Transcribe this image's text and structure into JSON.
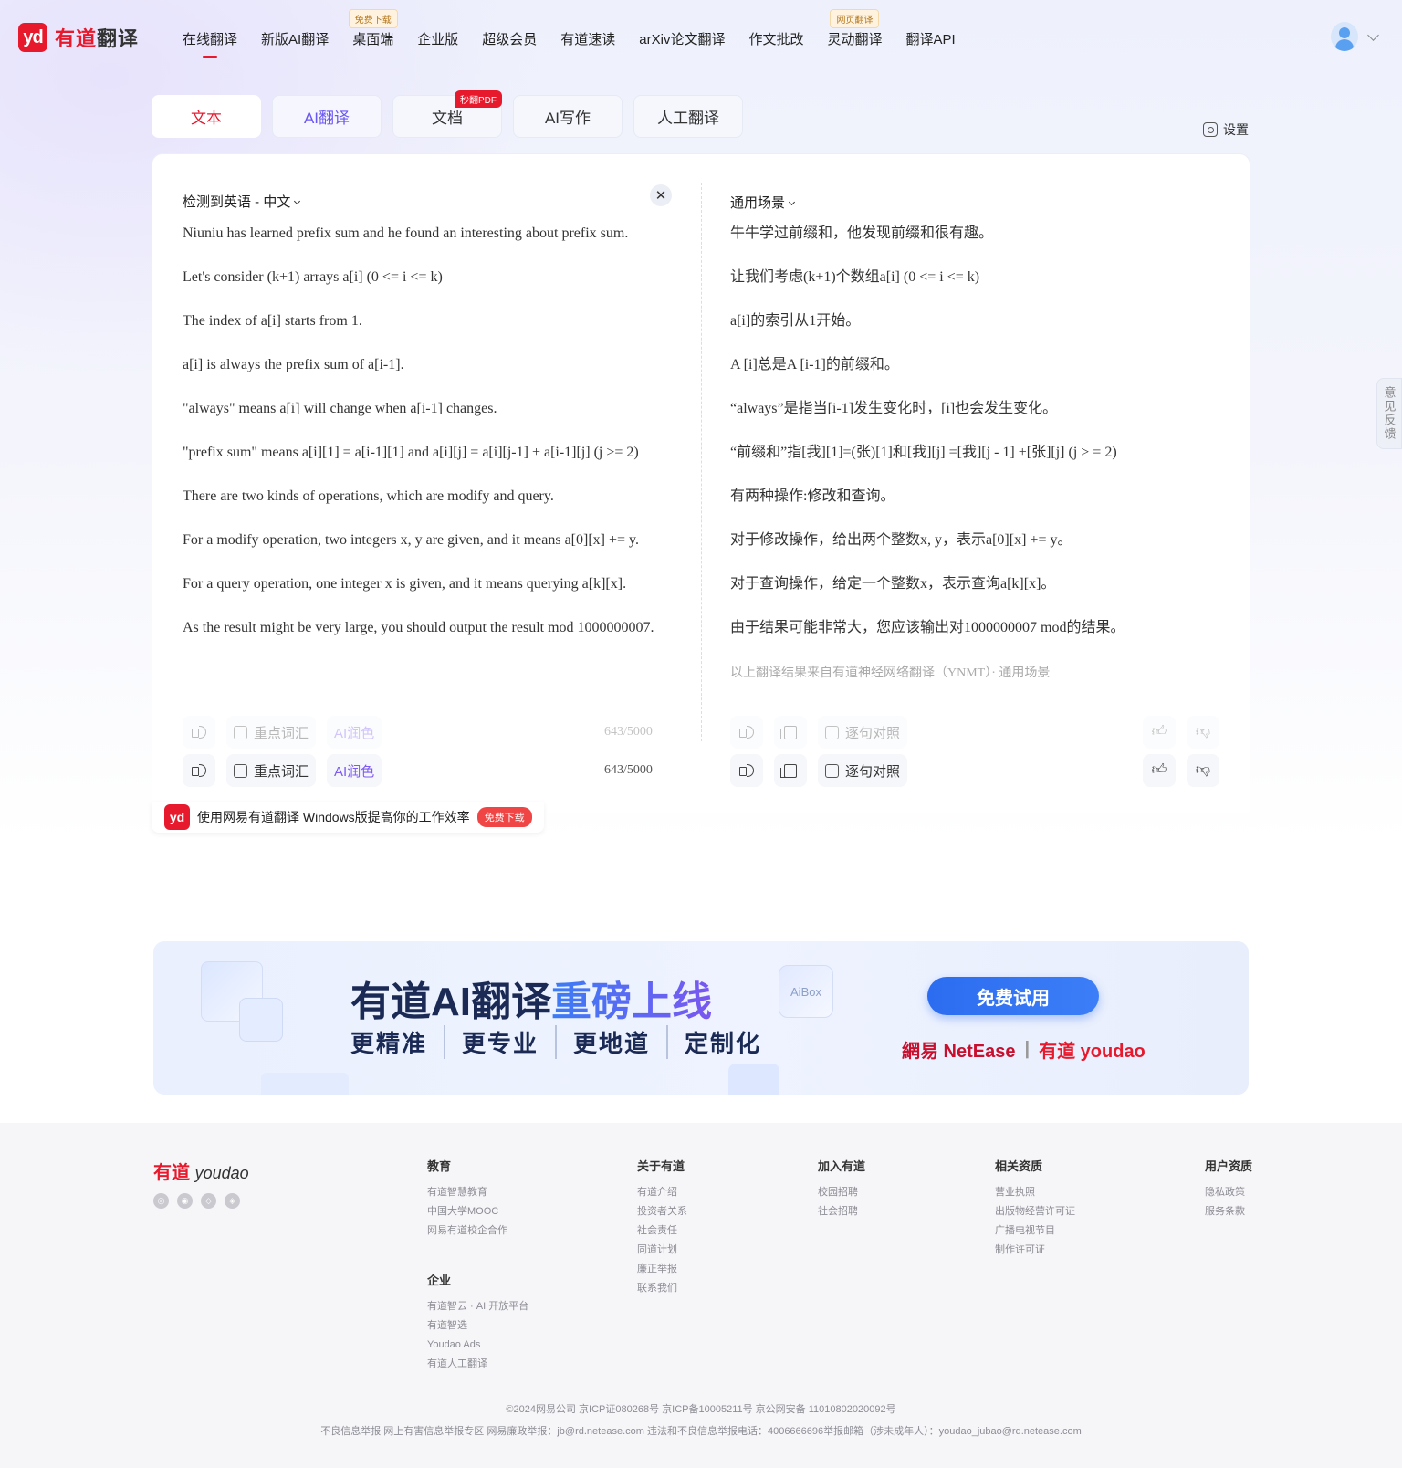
{
  "header": {
    "logo_badge": "yd",
    "logo_brand": "有道",
    "logo_product": "翻译",
    "nav": [
      {
        "label": "在线翻译",
        "tag": ""
      },
      {
        "label": "新版AI翻译",
        "tag": ""
      },
      {
        "label": "桌面端",
        "tag": "免费下载"
      },
      {
        "label": "企业版",
        "tag": ""
      },
      {
        "label": "超级会员",
        "tag": ""
      },
      {
        "label": "有道速读",
        "tag": ""
      },
      {
        "label": "arXiv论文翻译",
        "tag": ""
      },
      {
        "label": "作文批改",
        "tag": ""
      },
      {
        "label": "灵动翻译",
        "tag": "网页翻译"
      },
      {
        "label": "翻译API",
        "tag": ""
      }
    ]
  },
  "tabs": [
    {
      "label": "文本",
      "badge": ""
    },
    {
      "label": "AI翻译",
      "badge": ""
    },
    {
      "label": "文档",
      "badge": "秒翻PDF"
    },
    {
      "label": "AI写作",
      "badge": ""
    },
    {
      "label": "人工翻译",
      "badge": ""
    }
  ],
  "settings_label": "设置",
  "source": {
    "lang_label": "检测到英语 - 中文",
    "clear": "✕",
    "lines": [
      "Niuniu has learned prefix sum and he found an interesting about prefix sum.",
      "Let's consider (k+1) arrays a[i] (0 <= i <= k)",
      "The index of a[i] starts from 1.",
      "a[i] is always the prefix sum of a[i-1].",
      "\"always\" means a[i] will change when a[i-1] changes.",
      "\"prefix sum\" means a[i][1] = a[i-1][1] and a[i][j] = a[i][j-1] + a[i-1][j] (j >= 2)",
      "There are two kinds of operations, which are modify and query.",
      "For a modify operation, two integers x, y are given, and it means a[0][x] += y.",
      "For a query operation, one integer x is given, and it means querying a[k][x].",
      "As the result might be very large, you should output the result mod 1000000007."
    ],
    "keyword_label": "重点词汇",
    "polish_label": "AI润色",
    "count": "643/5000"
  },
  "target": {
    "scene_label": "通用场景",
    "lines": [
      "牛牛学过前缀和，他发现前缀和很有趣。",
      "让我们考虑(k+1)个数组a[i] (0 <= i <= k)",
      "a[i]的索引从1开始。",
      "A [i]总是A [i-1]的前缀和。",
      "“always”是指当[i-1]发生变化时，[i]也会发生变化。",
      "“前缀和”指[我][1]=(张)[1]和[我][j] =[我][j - 1] +[张][j] (j > = 2)",
      "有两种操作:修改和查询。",
      "对于修改操作，给出两个整数x, y，表示a[0][x] += y。",
      "对于查询操作，给定一个整数x，表示查询a[k][x]。",
      "由于结果可能非常大，您应该输出对1000000007 mod的结果。"
    ],
    "source_note": "以上翻译结果来自有道神经网络翻译（YNMT）· 通用场景",
    "compare_label": "逐句对照"
  },
  "promo": {
    "badge": "yd",
    "text": "使用网易有道翻译 Windows版提高你的工作效率",
    "button": "免费下载"
  },
  "feedback_label": "意见反馈",
  "banner": {
    "title_prefix": "有道AI翻译",
    "title_highlight": "重磅上线",
    "subs": [
      "更精准",
      "更专业",
      "更地道",
      "定制化"
    ],
    "button": "免费试用",
    "brand_netease": "網易 NetEase",
    "brand_youdao": "有道 youdao",
    "deco_label": "AiBox"
  },
  "footer": {
    "logo_cn": "有道",
    "logo_en": "youdao",
    "columns": [
      {
        "title": "教育",
        "items": [
          "有道智慧教育",
          "中国大学MOOC",
          "网易有道校企合作"
        ]
      },
      {
        "title": "企业",
        "items": [
          "有道智云 · AI 开放平台",
          "有道智选",
          "Youdao Ads",
          "有道人工翻译"
        ]
      },
      {
        "title": "关于有道",
        "items": [
          "有道介绍",
          "投资者关系",
          "社会责任",
          "同道计划",
          "廉正举报",
          "联系我们"
        ]
      },
      {
        "title": "加入有道",
        "items": [
          "校园招聘",
          "社会招聘"
        ]
      },
      {
        "title": "相关资质",
        "items": [
          "营业执照",
          "出版物经营许可证",
          "广播电视节目",
          "制作许可证"
        ]
      },
      {
        "title": "用户资质",
        "items": [
          "隐私政策",
          "服务条款"
        ]
      }
    ],
    "copyright": "©2024网易公司 京ICP证080268号 京ICP备10005211号 京公网安备 11010802020092号",
    "report": "不良信息举报  网上有害信息举报专区  网易廉政举报：jb@rd.netease.com 违法和不良信息举报电话：4006666696举报邮箱（涉未成年人）：youdao_jubao@rd.netease.com"
  }
}
